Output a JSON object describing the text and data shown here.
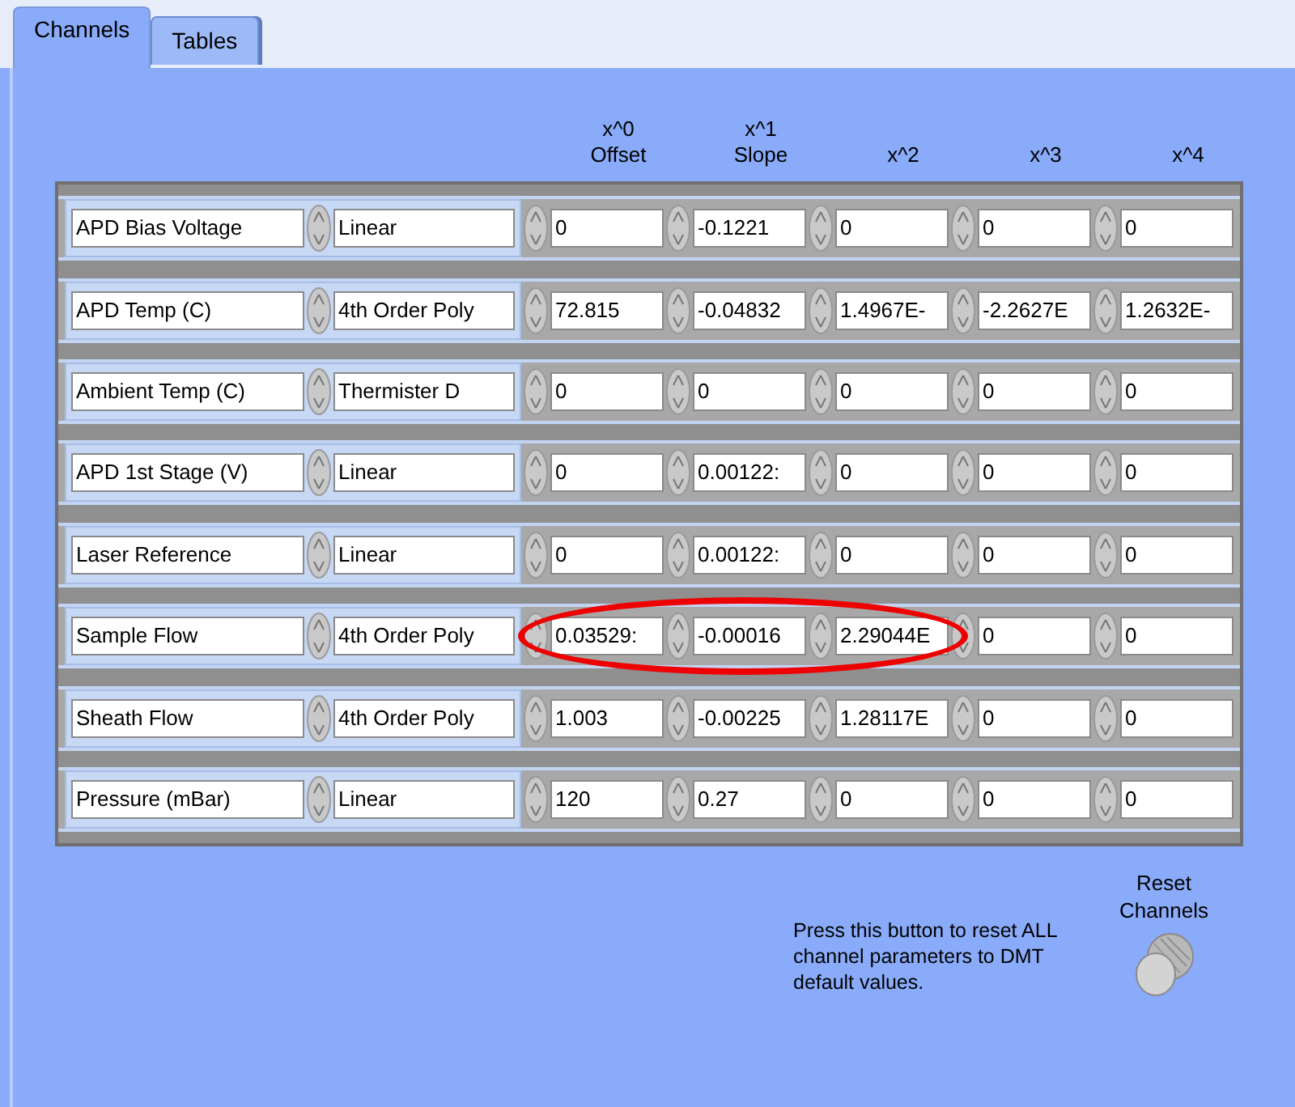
{
  "tabs": [
    {
      "label": "Channels",
      "selected": true
    },
    {
      "label": "Tables",
      "selected": false
    }
  ],
  "columns": [
    {
      "power": "x^0",
      "name": "Offset"
    },
    {
      "power": "x^1",
      "name": "Slope"
    },
    {
      "power": "x^2"
    },
    {
      "power": "x^3"
    },
    {
      "power": "x^4"
    }
  ],
  "channels": [
    {
      "name": "APD Bias Voltage",
      "type": "Linear",
      "coefficients": [
        "0",
        "-0.1221",
        "0",
        "0",
        "0"
      ],
      "highlighted": false
    },
    {
      "name": "APD Temp (C)",
      "type": "4th Order Poly",
      "coefficients": [
        "72.815",
        "-0.04832",
        "1.4967E-",
        "-2.2627E",
        "1.2632E-"
      ],
      "highlighted": false
    },
    {
      "name": "Ambient Temp (C)",
      "type": "Thermister D",
      "coefficients": [
        "0",
        "0",
        "0",
        "0",
        "0"
      ],
      "highlighted": false
    },
    {
      "name": "APD 1st Stage (V)",
      "type": "Linear",
      "coefficients": [
        "0",
        "0.00122:",
        "0",
        "0",
        "0"
      ],
      "highlighted": false
    },
    {
      "name": "Laser Reference",
      "type": "Linear",
      "coefficients": [
        "0",
        "0.00122:",
        "0",
        "0",
        "0"
      ],
      "highlighted": false
    },
    {
      "name": "Sample Flow",
      "type": "4th Order Poly",
      "coefficients": [
        "0.03529:",
        "-0.00016",
        "2.29044E",
        "0",
        "0"
      ],
      "highlighted": true
    },
    {
      "name": "Sheath Flow",
      "type": "4th Order Poly",
      "coefficients": [
        "1.003",
        "-0.00225",
        "1.28117E",
        "0",
        "0"
      ],
      "highlighted": false
    },
    {
      "name": "Pressure (mBar)",
      "type": "Linear",
      "coefficients": [
        "120",
        "0.27",
        "0",
        "0",
        "0"
      ],
      "highlighted": false
    }
  ],
  "reset": {
    "note": "Press this button to reset ALL channel parameters to DMT default values.",
    "label": "Reset Channels"
  }
}
